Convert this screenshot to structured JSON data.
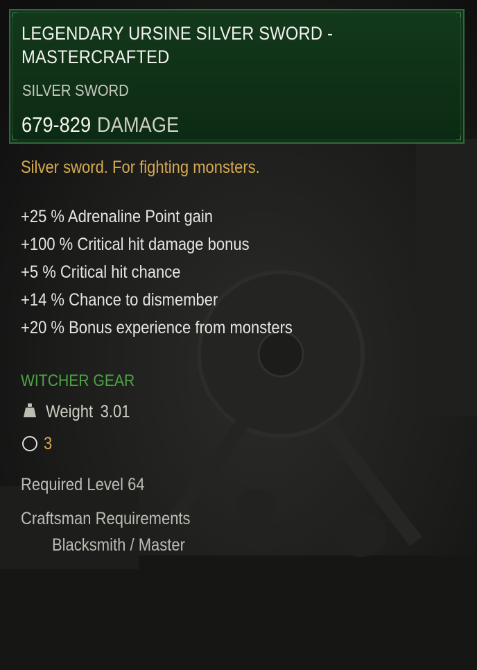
{
  "item": {
    "name": "LEGENDARY URSINE SILVER SWORD - MASTERCRAFTED",
    "type": "SILVER SWORD",
    "damage_value": "679-829",
    "damage_label": "DAMAGE",
    "description": "Silver sword. For fighting monsters.",
    "stats": [
      "+25 % Adrenaline Point gain",
      "+100 % Critical hit damage bonus",
      "+5 % Critical hit chance",
      "+14 % Chance to dismember",
      "+20 % Bonus experience from monsters"
    ],
    "gear_set": "WITCHER GEAR",
    "weight_label": "Weight",
    "weight_value": "3.01",
    "slots": "3",
    "required_level": "Required Level 64",
    "craftsman_label": "Craftsman Requirements",
    "craftsman_value": "Blacksmith / Master"
  },
  "icons": {
    "weight": "weight-icon",
    "slot": "upgrade-slot-icon"
  },
  "colors": {
    "header_bg": "#0f3016",
    "header_border": "#2f6b3a",
    "description": "#d7aa50",
    "gear_set": "#4ea445",
    "slot_count": "#d7aa50",
    "stat_text": "#e6e6e0"
  }
}
